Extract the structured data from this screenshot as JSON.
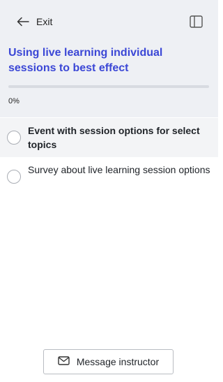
{
  "header": {
    "exit_label": "Exit",
    "exit_icon": "arrow-left-icon",
    "sidebar_toggle_icon": "sidebar-panel-icon"
  },
  "course": {
    "title": "Using live learning individual sessions to best effect",
    "progress_percent": 0,
    "progress_label": "0%",
    "accent_color": "#3b47d6"
  },
  "lessons": [
    {
      "label": "Event with session options for select topics",
      "active": true,
      "completed": false
    },
    {
      "label": "Survey about live learning session options",
      "active": false,
      "completed": false
    }
  ],
  "footer": {
    "message_label": "Message instructor",
    "message_icon": "mail-icon"
  }
}
